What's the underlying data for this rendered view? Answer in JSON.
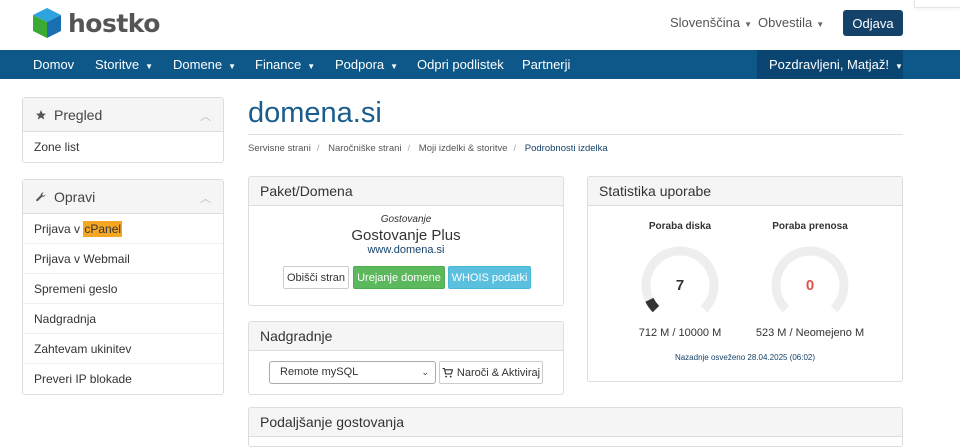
{
  "header": {
    "logo_text": "hostko",
    "language": "Slovenščina",
    "notifications": "Obvestila",
    "logout": "Odjava"
  },
  "nav": {
    "items": [
      "Domov",
      "Storitve",
      "Domene",
      "Finance",
      "Podpora",
      "Odpri podlistek",
      "Partnerji"
    ],
    "user": "Pozdravljeni, Matjaž!"
  },
  "sidebar": {
    "overview": {
      "title": "Pregled",
      "items": [
        "Zone list"
      ]
    },
    "actions": {
      "title": "Opravi",
      "items": [
        {
          "prefix": "Prijava v ",
          "highlight": "cPanel"
        },
        {
          "prefix": "Prijava v Webmail",
          "highlight": ""
        },
        {
          "prefix": "Spremeni geslo",
          "highlight": ""
        },
        {
          "prefix": "Nadgradnja",
          "highlight": ""
        },
        {
          "prefix": "Zahtevam ukinitev",
          "highlight": ""
        },
        {
          "prefix": "Preveri IP blokade",
          "highlight": ""
        }
      ]
    }
  },
  "main": {
    "title": "domena.si",
    "breadcrumb": [
      "Servisne strani",
      "Naročniške strani",
      "Moji izdelki & storitve",
      "Podrobnosti izdelka"
    ]
  },
  "package": {
    "heading": "Paket/Domena",
    "type": "Gostovanje",
    "name": "Gostovanje Plus",
    "domain": "www.domena.si",
    "buttons": [
      "Obišči stran",
      "Urejanje domene",
      "WHOIS podatki"
    ]
  },
  "upgrades": {
    "heading": "Nadgradnje",
    "selected": "Remote mySQL",
    "order_button": "Naroči & Aktiviraj"
  },
  "extend": {
    "heading": "Podaljšanje gostovanja"
  },
  "stats": {
    "heading": "Statistika uporabe",
    "disk": {
      "label": "Poraba diska",
      "value": "7",
      "detail": "712 M / 10000 M",
      "fraction": 0.0712
    },
    "bandwidth": {
      "label": "Poraba prenosa",
      "value": "0",
      "detail": "523 M / Neomejeno M",
      "fraction": 0
    },
    "refreshed": "Nazadnje osveženo 28.04.2025 (06:02)"
  },
  "colors": {
    "primary": "#0d5889",
    "dark": "#15426a",
    "success": "#5cb85c",
    "info": "#5bc0de",
    "highlight": "#f5a623",
    "zero": "#d9534f"
  }
}
